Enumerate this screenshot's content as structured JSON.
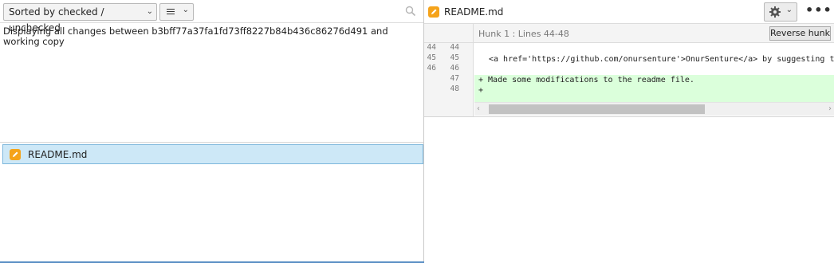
{
  "left": {
    "sort_label": "Sorted by checked / unchecked",
    "changes_info": "Displaying all changes between b3bff77a37fa1fd73ff8227b84b436c86276d491 and working copy",
    "files": [
      {
        "name": "README.md",
        "status_icon": "pencil-icon"
      }
    ]
  },
  "right": {
    "file_title": "README.md",
    "hunk_title": "Hunk 1 : Lines 44-48",
    "reverse_label": "Reverse hunk",
    "more_label": "•••",
    "lines": [
      {
        "old": "44",
        "new": "44",
        "text": "",
        "type": "context"
      },
      {
        "old": "45",
        "new": "45",
        "text": "<a href='https://github.com/onursenture'>OnurSenture</a> by suggesting t",
        "type": "context"
      },
      {
        "old": "46",
        "new": "46",
        "text": "",
        "type": "context"
      },
      {
        "old": "",
        "new": "47",
        "text": "+ Made some modifications to the readme file.",
        "type": "added"
      },
      {
        "old": "",
        "new": "48",
        "text": "+",
        "type": "added"
      }
    ]
  },
  "colors": {
    "added_bg": "#dbffdb",
    "selection_bg": "#cde8f7",
    "modified_badge": "#f5a31a"
  }
}
